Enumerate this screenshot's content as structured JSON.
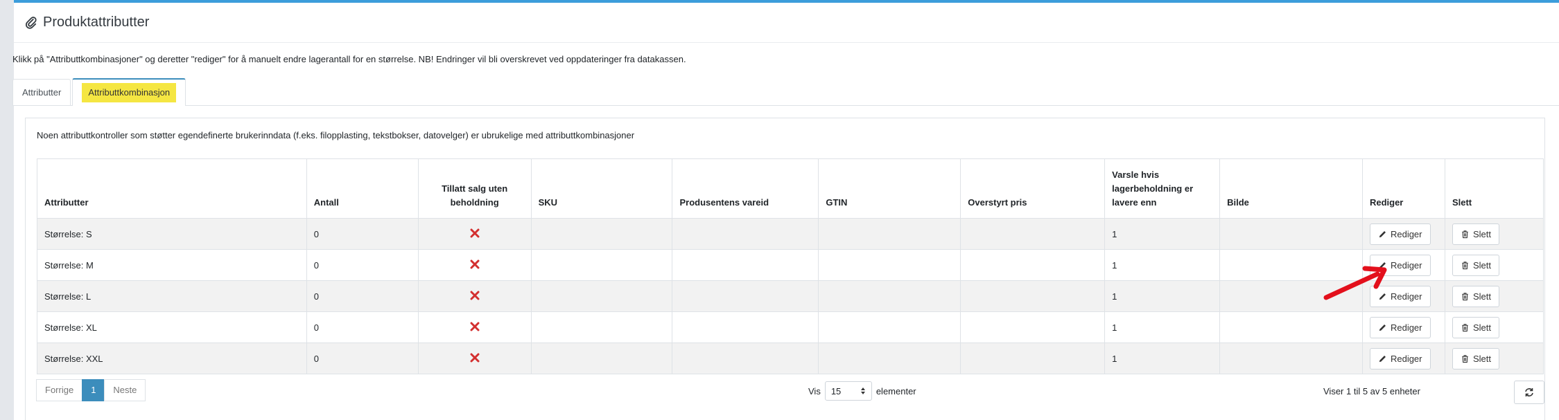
{
  "header": {
    "title": "Produktattributter",
    "icon": "paperclip-icon"
  },
  "notice": "Klikk på \"Attributtkombinasjoner\" og deretter \"rediger\" for å manuelt endre lagerantall for en størrelse. NB! Endringer vil bli overskrevet ved oppdateringer fra datakassen.",
  "tabs": [
    {
      "label": "Attributter",
      "active": false
    },
    {
      "label": "Attributtkombinasjon",
      "active": true
    }
  ],
  "info": "Noen attributtkontroller som støtter egendefinerte brukerinndata (f.eks. filopplasting, tekstbokser, datovelger) er ubrukelige med attributtkombinasjoner",
  "table": {
    "columns": [
      "Attributter",
      "Antall",
      "Tillatt salg uten beholdning",
      "SKU",
      "Produsentens vareid",
      "GTIN",
      "Overstyrt pris",
      "Varsle hvis lagerbeholdning er lavere enn",
      "Bilde",
      "Rediger",
      "Slett"
    ],
    "rows": [
      {
        "attribute": "Størrelse: S",
        "quantity": "0",
        "allow_oos": false,
        "sku": "",
        "manufacturer_id": "",
        "gtin": "",
        "override_price": "",
        "notify_below": "1",
        "image": "",
        "edit_label": "Rediger",
        "delete_label": "Slett"
      },
      {
        "attribute": "Størrelse: M",
        "quantity": "0",
        "allow_oos": false,
        "sku": "",
        "manufacturer_id": "",
        "gtin": "",
        "override_price": "",
        "notify_below": "1",
        "image": "",
        "edit_label": "Rediger",
        "delete_label": "Slett"
      },
      {
        "attribute": "Størrelse: L",
        "quantity": "0",
        "allow_oos": false,
        "sku": "",
        "manufacturer_id": "",
        "gtin": "",
        "override_price": "",
        "notify_below": "1",
        "image": "",
        "edit_label": "Rediger",
        "delete_label": "Slett"
      },
      {
        "attribute": "Størrelse: XL",
        "quantity": "0",
        "allow_oos": false,
        "sku": "",
        "manufacturer_id": "",
        "gtin": "",
        "override_price": "",
        "notify_below": "1",
        "image": "",
        "edit_label": "Rediger",
        "delete_label": "Slett"
      },
      {
        "attribute": "Størrelse: XXL",
        "quantity": "0",
        "allow_oos": false,
        "sku": "",
        "manufacturer_id": "",
        "gtin": "",
        "override_price": "",
        "notify_below": "1",
        "image": "",
        "edit_label": "Rediger",
        "delete_label": "Slett"
      }
    ]
  },
  "pagination": {
    "prev": "Forrige",
    "current": "1",
    "next": "Neste"
  },
  "page_size": {
    "prefix": "Vis",
    "value": "15",
    "suffix": "elementer"
  },
  "summary": "Viser 1 til 5 av 5 enheter",
  "colors": {
    "accent": "#3c8dbc",
    "highlight": "#f5e642",
    "delete_mark": "#d32f2f",
    "annotation_arrow": "#e3101c"
  }
}
